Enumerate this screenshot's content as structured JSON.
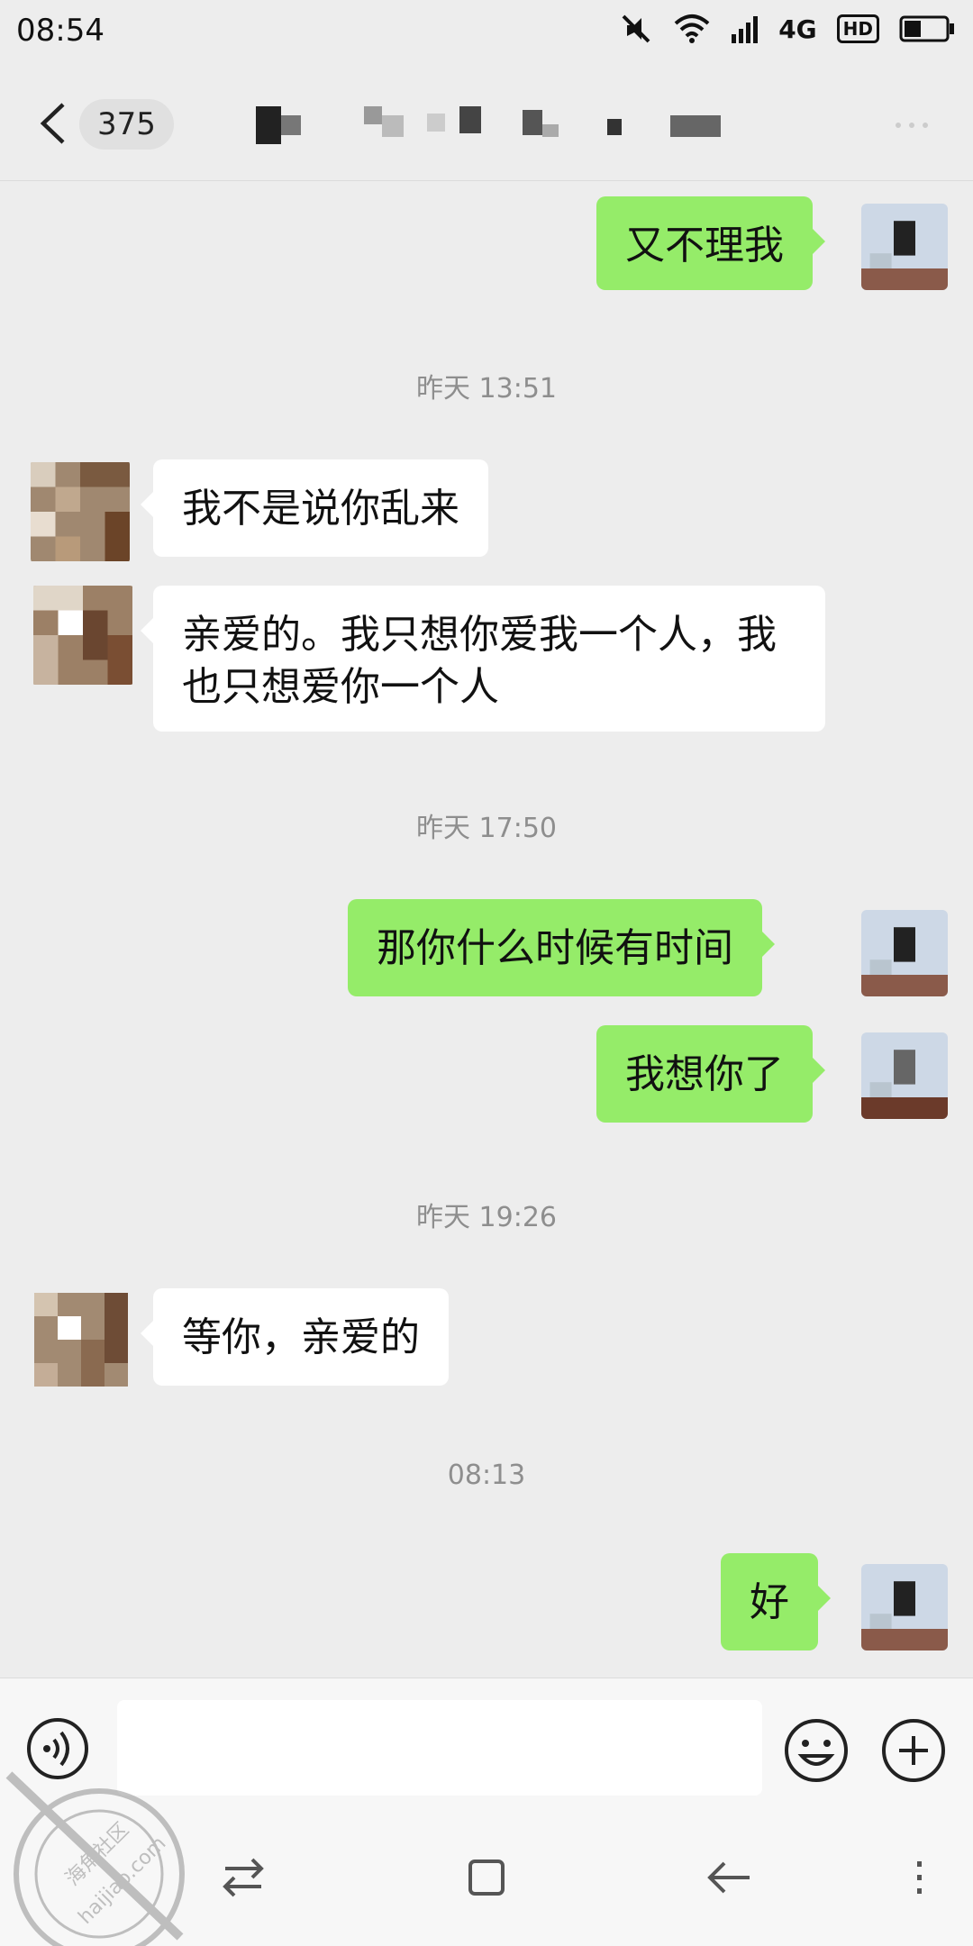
{
  "status_bar": {
    "time": "08:54",
    "network": "4G",
    "hd": "HD"
  },
  "header": {
    "unread_count": "375"
  },
  "messages": [
    {
      "side": "out",
      "text": "又不理我"
    },
    {
      "side": "time",
      "text": "昨天 13:51"
    },
    {
      "side": "in",
      "text": "我不是说你乱来"
    },
    {
      "side": "in",
      "text": "亲爱的。我只想你爱我一个人，我也只想爱你一个人"
    },
    {
      "side": "time",
      "text": "昨天 17:50"
    },
    {
      "side": "out",
      "text": "那你什么时候有时间"
    },
    {
      "side": "out",
      "text": "我想你了"
    },
    {
      "side": "time",
      "text": "昨天 19:26"
    },
    {
      "side": "in",
      "text": "等你，亲爱的"
    },
    {
      "side": "time",
      "text": "08:13"
    },
    {
      "side": "out",
      "text": "好"
    }
  ],
  "icons": {
    "back": "chevron-left-icon",
    "voice": "voice-icon",
    "emoji": "emoji-icon",
    "plus": "plus-icon",
    "nav": [
      "switch-icon",
      "square-icon",
      "back-arrow-icon",
      "menu-icon"
    ]
  },
  "watermark": {
    "line1": "海角社区",
    "line2": "haijiao.com"
  },
  "colors": {
    "outgoing_bubble": "#95ec69",
    "incoming_bubble": "#ffffff",
    "background": "#ededed"
  }
}
